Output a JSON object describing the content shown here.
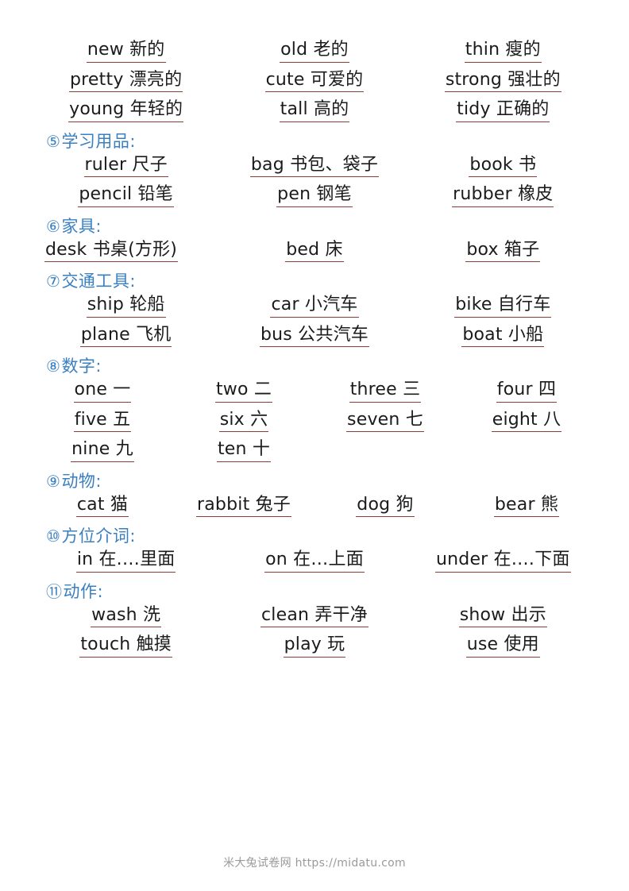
{
  "document": {
    "watermark": "米大兔试卷网 https://midatu.com",
    "accent_heading_color": "#3a80c1",
    "underline_color": "#8d3d38",
    "text_color": "#1b1b1b"
  },
  "top_block": {
    "name": "adjectives-continued",
    "columns": 3,
    "rows": [
      [
        "new 新的",
        "old 老的",
        "thin 瘦的"
      ],
      [
        "pretty 漂亮的",
        "cute 可爱的",
        "strong 强壮的"
      ],
      [
        "young 年轻的",
        "tall 高的",
        "tidy 正确的"
      ]
    ]
  },
  "sections": [
    {
      "number": "⑤",
      "title": "学习用品:",
      "name": "study-supplies",
      "columns": 3,
      "rows": [
        [
          "ruler 尺子",
          "bag 书包、袋子",
          "book 书"
        ],
        [
          "pencil 铅笔",
          "pen 钢笔",
          "rubber 橡皮"
        ]
      ]
    },
    {
      "number": "⑥",
      "title": "家具:",
      "name": "furniture",
      "columns": 3,
      "rows": [
        [
          "desk 书桌(方形)",
          "bed 床",
          "box 箱子"
        ]
      ]
    },
    {
      "number": "⑦",
      "title": "交通工具:",
      "name": "transportation",
      "columns": 3,
      "rows": [
        [
          "ship 轮船",
          "car 小汽车",
          "bike 自行车"
        ],
        [
          "plane 飞机",
          "bus 公共汽车",
          "boat 小船"
        ]
      ]
    },
    {
      "number": "⑧",
      "title": "数字:",
      "name": "numbers",
      "columns": 4,
      "rows": [
        [
          "one 一",
          "two 二",
          "three 三",
          "four 四"
        ],
        [
          "five 五",
          "six 六",
          "seven 七",
          "eight 八"
        ],
        [
          "nine 九",
          "ten 十",
          "",
          ""
        ]
      ]
    },
    {
      "number": "⑨",
      "title": "动物:",
      "name": "animals",
      "columns": 4,
      "rows": [
        [
          "cat 猫",
          "rabbit 兔子",
          "dog 狗",
          "bear 熊"
        ]
      ]
    },
    {
      "number": "⑩",
      "title": "方位介词:",
      "name": "position-prepositions",
      "columns": 3,
      "rows": [
        [
          "in 在.…里面",
          "on 在…上面",
          "under 在.…下面"
        ]
      ]
    },
    {
      "number": "⑪",
      "title": "动作:",
      "name": "actions",
      "columns": 3,
      "rows": [
        [
          "wash 洗",
          "clean 弄干净",
          "show 出示"
        ],
        [
          "touch 触摸",
          "play 玩",
          "use 使用"
        ]
      ]
    }
  ]
}
